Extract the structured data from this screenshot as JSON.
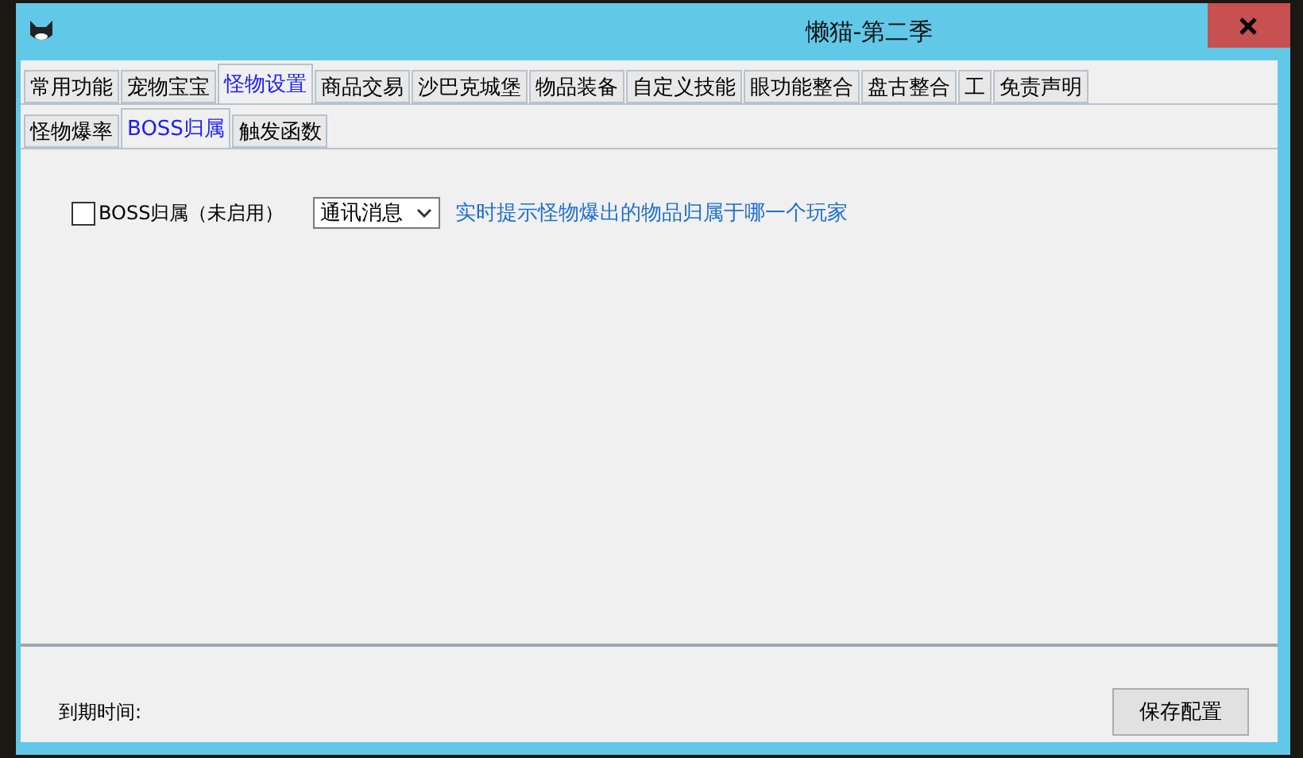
{
  "window": {
    "title": "懒猫-第二季"
  },
  "tabs": [
    {
      "label": "常用功能",
      "selected": false
    },
    {
      "label": "宠物宝宝",
      "selected": false
    },
    {
      "label": "怪物设置",
      "selected": true
    },
    {
      "label": "商品交易",
      "selected": false
    },
    {
      "label": "沙巴克城堡",
      "selected": false
    },
    {
      "label": "物品装备",
      "selected": false
    },
    {
      "label": "自定义技能",
      "selected": false
    },
    {
      "label": "眼功能整合",
      "selected": false
    },
    {
      "label": "盘古整合",
      "selected": false
    },
    {
      "label": "工",
      "selected": false
    },
    {
      "label": "免责声明",
      "selected": false
    }
  ],
  "subtabs": [
    {
      "label": "怪物爆率",
      "selected": false
    },
    {
      "label": "BOSS归属",
      "selected": true
    },
    {
      "label": "触发函数",
      "selected": false
    }
  ],
  "setting": {
    "label": "BOSS归属（未启用）",
    "checked": false,
    "dropdown": "通讯消息",
    "hint": "实时提示怪物爆出的物品归属于哪一个玩家"
  },
  "footer": {
    "expiry_label": "到期时间:",
    "save_button": "保存配置"
  }
}
